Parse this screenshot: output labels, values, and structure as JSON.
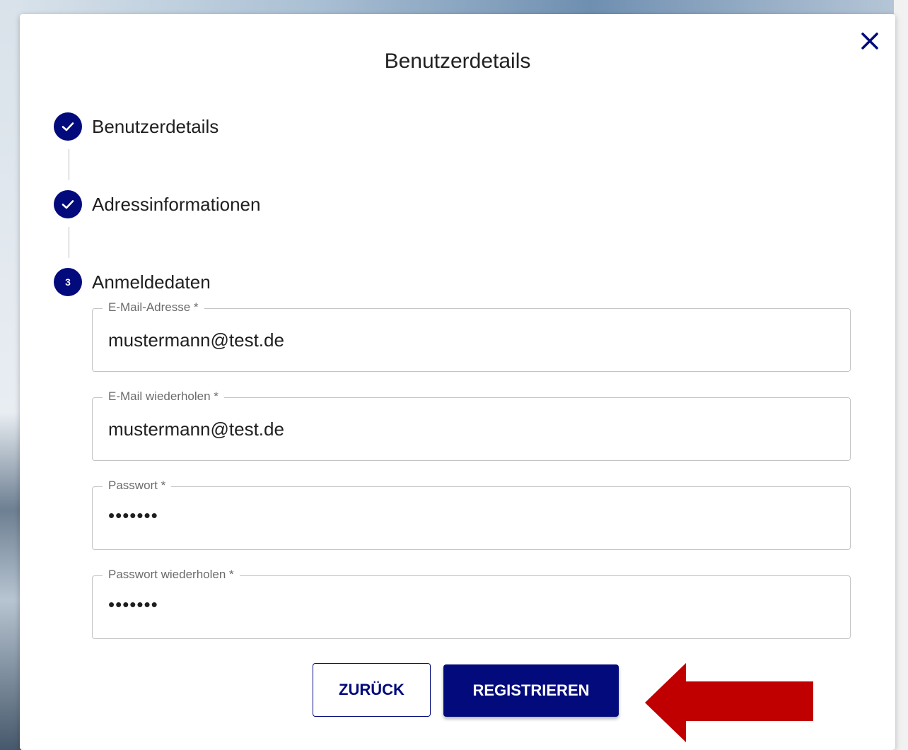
{
  "modal": {
    "title": "Benutzerdetails",
    "close_icon": "close-icon"
  },
  "stepper": {
    "steps": [
      {
        "label": "Benutzerdetails",
        "state": "completed",
        "icon": "check-icon"
      },
      {
        "label": "Adressinformationen",
        "state": "completed",
        "icon": "check-icon"
      },
      {
        "label": "Anmeldedaten",
        "state": "active",
        "number": "3"
      }
    ]
  },
  "form": {
    "email": {
      "label": "E-Mail-Adresse *",
      "value": "mustermann@test.de"
    },
    "email_repeat": {
      "label": "E-Mail wiederholen *",
      "value": "mustermann@test.de"
    },
    "password": {
      "label": "Passwort *",
      "value": "•••••••"
    },
    "password_repeat": {
      "label": "Passwort wiederholen *",
      "value": "•••••••"
    }
  },
  "actions": {
    "back_label": "ZURÜCK",
    "register_label": "REGISTRIEREN"
  },
  "annotation": {
    "arrow_color": "#c00000",
    "icon": "arrow-left-icon"
  },
  "colors": {
    "primary": "#020a7c",
    "annotation_red": "#c00000"
  }
}
